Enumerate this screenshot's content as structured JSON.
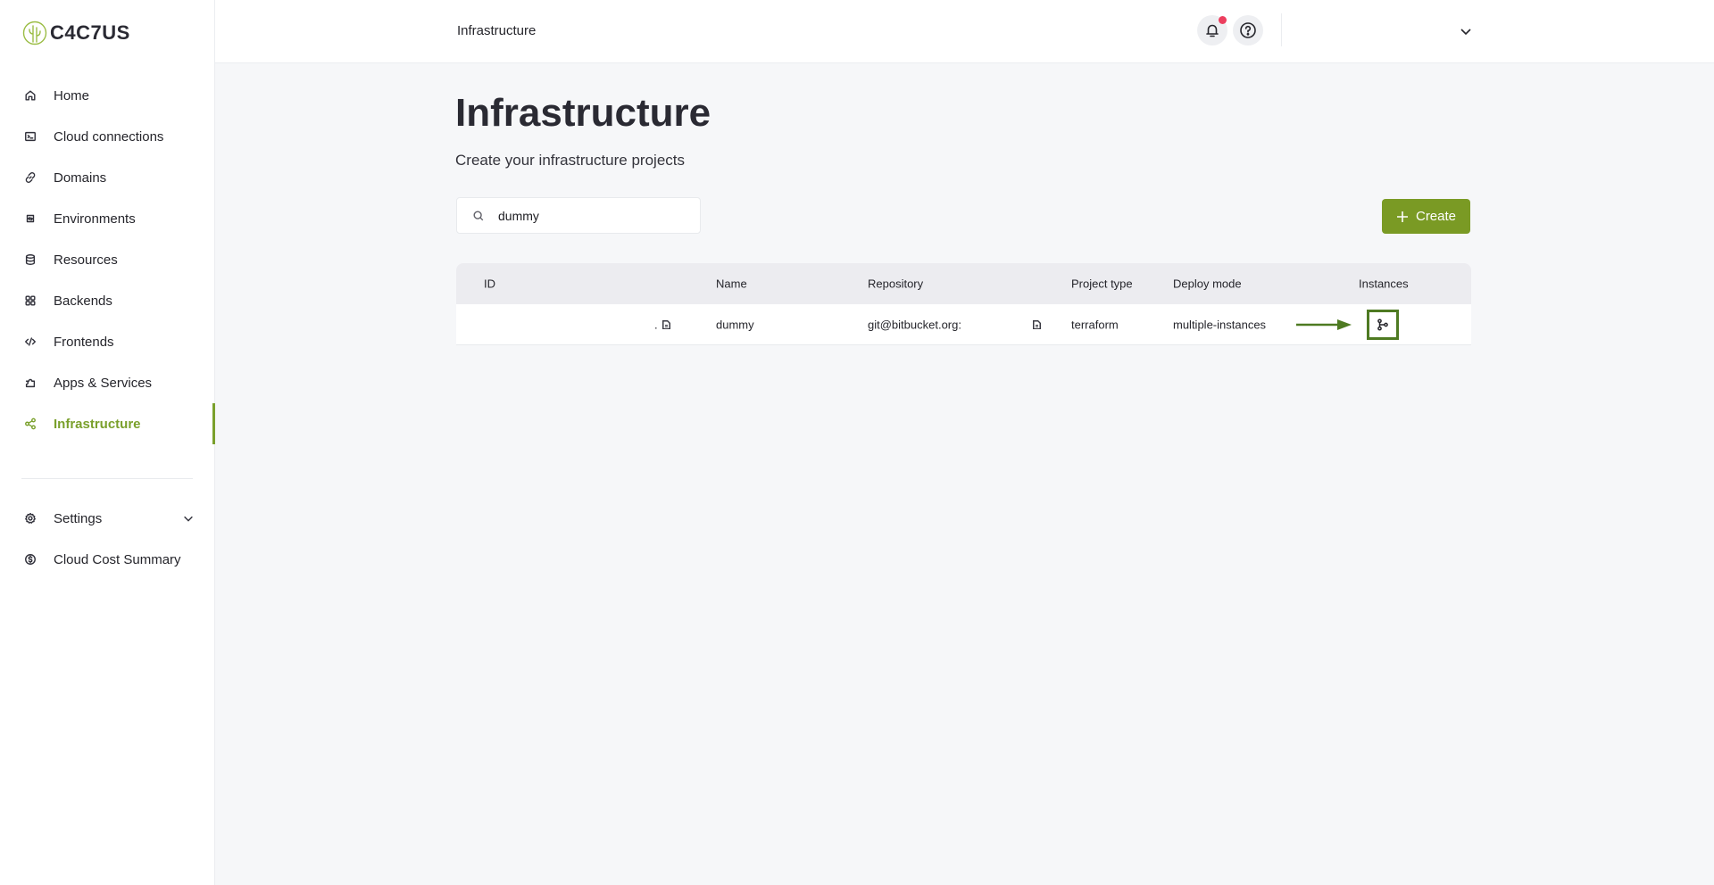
{
  "app": {
    "logo_text": "C4C7US"
  },
  "sidebar": {
    "items": [
      {
        "label": "Home",
        "icon": "home-icon"
      },
      {
        "label": "Cloud connections",
        "icon": "terminal-icon"
      },
      {
        "label": "Domains",
        "icon": "link-icon"
      },
      {
        "label": "Environments",
        "icon": "environments-icon"
      },
      {
        "label": "Resources",
        "icon": "database-icon"
      },
      {
        "label": "Backends",
        "icon": "grid-icon"
      },
      {
        "label": "Frontends",
        "icon": "code-icon"
      },
      {
        "label": "Apps & Services",
        "icon": "puzzle-icon"
      },
      {
        "label": "Infrastructure",
        "icon": "share-nodes-icon",
        "active": true
      }
    ],
    "bottom_items": [
      {
        "label": "Settings",
        "icon": "gear-icon",
        "expandable": true
      },
      {
        "label": "Cloud Cost Summary",
        "icon": "dollar-circle-icon"
      }
    ]
  },
  "header": {
    "breadcrumb": "Infrastructure",
    "notification_badge": true
  },
  "main": {
    "title": "Infrastructure",
    "subtitle": "Create your infrastructure projects",
    "search": {
      "value": "dummy",
      "placeholder": ""
    },
    "create_label": "Create"
  },
  "table": {
    "columns": [
      "ID",
      "Name",
      "Repository",
      "Project type",
      "Deploy mode",
      "Instances"
    ],
    "rows": [
      {
        "id": ".",
        "name": "dummy",
        "repository": "git@bitbucket.org:",
        "project_type": "terraform",
        "deploy_mode": "multiple-instances"
      }
    ]
  },
  "colors": {
    "accent": "#7aa02c",
    "button": "#7a9a24",
    "highlight_box": "#4e7a22",
    "badge": "#ec3e5e"
  }
}
